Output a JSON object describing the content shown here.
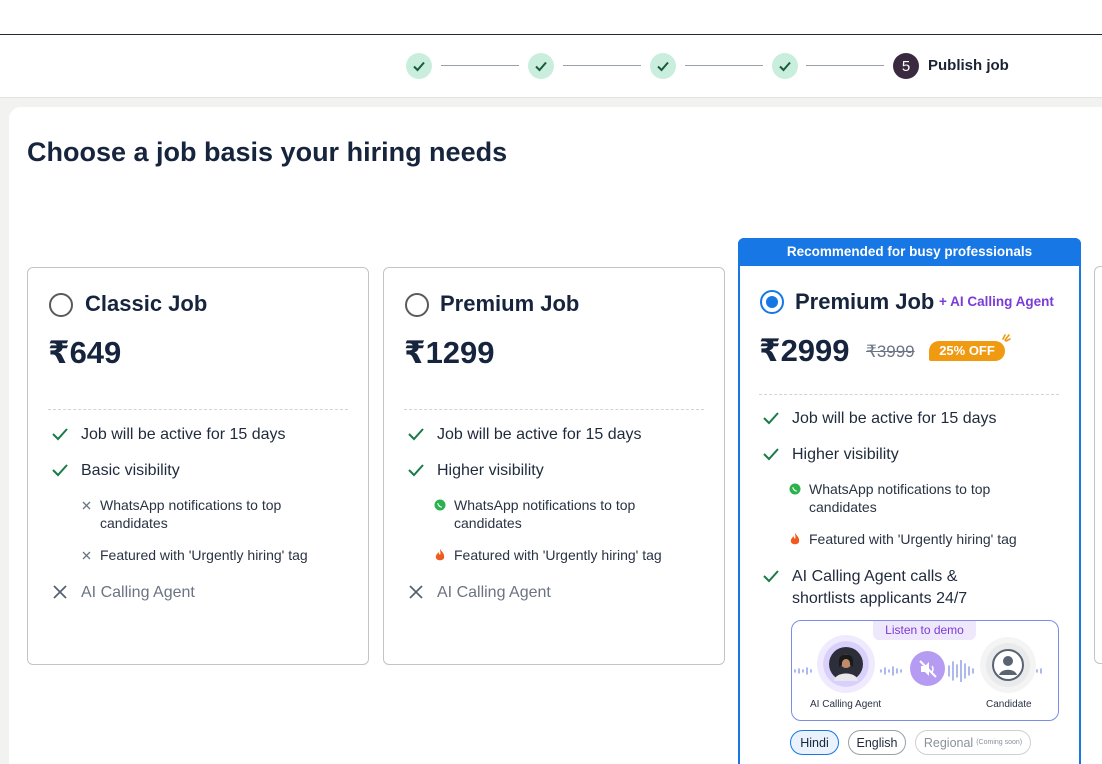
{
  "stepper": {
    "completed_steps": 4,
    "current_step_number": "5",
    "current_step_label": "Publish job"
  },
  "page_title": "Choose a job basis your hiring needs",
  "plans": [
    {
      "title": "Classic Job",
      "price": "₹649",
      "selected": false,
      "features": [
        {
          "text": "Job will be active for 15 days",
          "icon": "check-icon"
        },
        {
          "text": "Basic visibility",
          "icon": "check-icon"
        }
      ],
      "sub_features": [
        {
          "text": "WhatsApp notifications to top candidates",
          "icon": "small-x-icon"
        },
        {
          "text": "Featured with 'Urgently hiring' tag",
          "icon": "small-x-icon"
        }
      ],
      "ai_agent": {
        "text": "AI Calling Agent",
        "icon": "x-icon"
      }
    },
    {
      "title": "Premium Job",
      "price": "₹1299",
      "selected": false,
      "features": [
        {
          "text": "Job will be active for 15 days",
          "icon": "check-icon"
        },
        {
          "text": "Higher visibility",
          "icon": "check-icon"
        }
      ],
      "sub_features": [
        {
          "text": "WhatsApp notifications to top candidates",
          "icon": "whatsapp-icon"
        },
        {
          "text": "Featured with 'Urgently hiring' tag",
          "icon": "fire-icon"
        }
      ],
      "ai_agent": {
        "text": "AI Calling Agent",
        "icon": "x-icon"
      }
    },
    {
      "recommended_label": "Recommended for busy professionals",
      "title": "Premium Job",
      "addon": "+ AI Calling Agent",
      "price": "₹2999",
      "original_price": "₹3999",
      "discount": "25% OFF",
      "selected": true,
      "features": [
        {
          "text": "Job will be active for 15 days",
          "icon": "check-icon"
        },
        {
          "text": "Higher visibility",
          "icon": "check-icon"
        }
      ],
      "sub_features": [
        {
          "text": "WhatsApp notifications to top candidates",
          "icon": "whatsapp-icon"
        },
        {
          "text": "Featured with 'Urgently hiring' tag",
          "icon": "fire-icon"
        }
      ],
      "ai_agent": {
        "text": "AI Calling Agent calls & shortlists applicants 24/7",
        "icon": "check-icon"
      },
      "demo": {
        "listen_label": "Listen to demo",
        "agent_caption": "AI Calling Agent",
        "candidate_caption": "Candidate"
      },
      "languages": [
        {
          "label": "Hindi",
          "selected": true
        },
        {
          "label": "English",
          "selected": false
        },
        {
          "label": "Regional",
          "note": "(Coming soon)",
          "disabled": true
        }
      ]
    }
  ],
  "colors": {
    "primary_blue": "#1677e5",
    "check_green": "#1a7a4a",
    "addon_purple": "#7a3cd6",
    "discount_orange": "#f09a12",
    "title_navy": "#16253d"
  }
}
